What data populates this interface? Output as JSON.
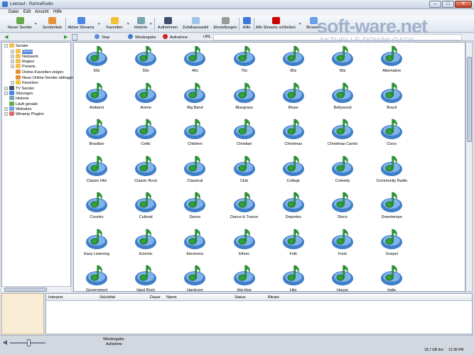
{
  "window": {
    "title": "Leerlauf - RarmaRadio",
    "min": "–",
    "max": "□",
    "close": "✕"
  },
  "menu": [
    "Datei",
    "Edit",
    "Ansicht",
    "Hilfe"
  ],
  "toolbar": [
    {
      "label": "Neuer Sender",
      "icon": "new-station-icon",
      "color": "#6aa84f"
    },
    {
      "label": "Senderliste",
      "icon": "station-list-icon",
      "color": "#e69138"
    },
    {
      "label": "Aktive Streams",
      "icon": "streams-icon",
      "color": "#4a86e8"
    },
    {
      "label": "Favoriten",
      "icon": "favorites-icon",
      "color": "#f1c232"
    },
    {
      "label": "Historie",
      "icon": "history-icon",
      "color": "#76a5af"
    },
    {
      "label": "Aufnehmen",
      "icon": "record-icon",
      "color": "#3d4f6b"
    },
    {
      "label": "Zufallsauswahl",
      "icon": "shuffle-icon",
      "color": "#9fc5e8"
    },
    {
      "label": "Einstellungen",
      "icon": "settings-icon",
      "color": "#999999"
    },
    {
      "label": "Hilfe",
      "icon": "help-icon",
      "color": "#3c78d8"
    },
    {
      "label": "Alle Streams schließen",
      "icon": "close-streams-icon",
      "color": "#cc0000"
    },
    {
      "label": "Browser",
      "icon": "browser-icon",
      "color": "#6d9eeb"
    }
  ],
  "addressbar": {
    "stop": "Stop",
    "play": "Wiedergabe",
    "record": "Aufnahme",
    "url": "URL"
  },
  "tree": [
    {
      "label": "Sender",
      "color": "#e69138"
    },
    {
      "label": "Genre",
      "color": "#f2c14e"
    },
    {
      "label": "Netzwerk",
      "color": "#f2c14e"
    },
    {
      "label": "Region",
      "color": "#f2c14e"
    },
    {
      "label": "Presets",
      "color": "#f2c14e"
    },
    {
      "label": "Online-Favoriten zeigen",
      "color": "#e69138"
    },
    {
      "label": "Neue Online-Sender abfragen",
      "color": "#e69138"
    },
    {
      "label": "Favoriten",
      "color": "#f1c232"
    },
    {
      "label": "TV Sender",
      "color": "#3d4f6b"
    },
    {
      "label": "Sitzungen",
      "color": "#4a86e8"
    },
    {
      "label": "Historie",
      "color": "#76a5af"
    },
    {
      "label": "Läuft gerade",
      "color": "#6aa84f"
    },
    {
      "label": "Websites",
      "color": "#6d9eeb"
    },
    {
      "label": "Winamp Plugins",
      "color": "#e06666"
    }
  ],
  "genres": [
    "60s",
    "50s",
    "40s",
    "70s",
    "80s",
    "90s",
    "Alternative",
    "Ambient",
    "Anime",
    "Big Band",
    "Bluegrass",
    "Blues",
    "Bollywood",
    "Brazil",
    "Brasilian",
    "Celtic",
    "Children",
    "Christian",
    "Christmas",
    "Christmas Carols",
    "Cisco",
    "Classic Hits",
    "Classic Rock",
    "Classical",
    "Club",
    "College",
    "Comedy",
    "Community Radio",
    "Country",
    "Cultural",
    "Dance",
    "Dance & Trance",
    "Deportes",
    "Disco",
    "Downtempo",
    "Easy Listening",
    "Eclectic",
    "Electronic",
    "Ethnic",
    "Folk",
    "Funk",
    "Gospel",
    "Government",
    "Hard Rock",
    "Hardcore",
    "Hip-Hop",
    "Hits",
    "House",
    "Indie"
  ],
  "table_headers": [
    "Interpret",
    "Stücktitel",
    "Dauer",
    "Name",
    "Status",
    "Bitrate"
  ],
  "status": {
    "main": "Wiedergabe",
    "sub": "Aufnahme",
    "disk": "18,7 GB frei",
    "clock": "12:36 PM"
  },
  "watermark": {
    "logo": "soft-ware.net",
    "sub": "AKTUELLE DOWNLOADS"
  },
  "colors": {
    "note_green": "#2fa33a",
    "disc_blue": "#3f7ec8",
    "selection": "#3d7bd8"
  }
}
